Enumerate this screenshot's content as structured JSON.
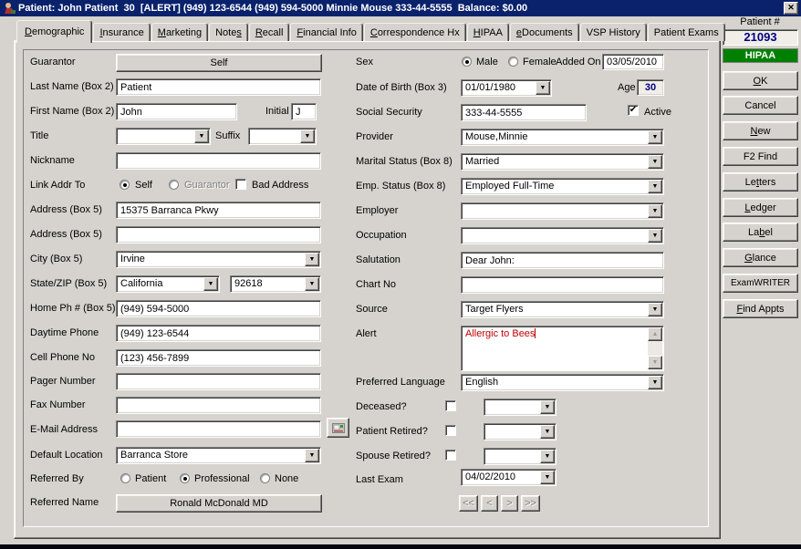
{
  "window": {
    "title": "Patient: John Patient  30  [ALERT] (949) 123-6544 (949) 594-5000 Minnie Mouse 333-44-5555  Balance: $0.00"
  },
  "icons": {
    "close": "✕",
    "dropdown": "▼",
    "check": "✔",
    "scroll_up": "▲",
    "scroll_down": "▼"
  },
  "colors": {
    "titlebar": "#0a216b",
    "chrome": "#d6d3ce",
    "hipaa_green": "#008000",
    "alert_red": "#c00000",
    "value_navy": "#000080"
  },
  "tabs": [
    {
      "pre": "",
      "key": "D",
      "post": "emographic"
    },
    {
      "pre": "",
      "key": "I",
      "post": "nsurance"
    },
    {
      "pre": "",
      "key": "M",
      "post": "arketing"
    },
    {
      "pre": "Note",
      "key": "s",
      "post": ""
    },
    {
      "pre": "",
      "key": "R",
      "post": "ecall"
    },
    {
      "pre": "",
      "key": "F",
      "post": "inancial Info"
    },
    {
      "pre": "",
      "key": "C",
      "post": "orrespondence Hx"
    },
    {
      "pre": "",
      "key": "H",
      "post": "IPAA"
    },
    {
      "pre": "",
      "key": "e",
      "post": "Documents"
    },
    {
      "pre": "VSP History",
      "key": "",
      "post": ""
    },
    {
      "pre": "Patient Exams",
      "key": "",
      "post": ""
    }
  ],
  "patient_panel": {
    "label": "Patient #",
    "number": "21093",
    "hipaa": "HIPAA"
  },
  "sidebar": {
    "buttons": [
      {
        "pre": "",
        "key": "O",
        "post": "K"
      },
      {
        "pre": "Cancel",
        "key": "",
        "post": ""
      },
      {
        "pre": "",
        "key": "N",
        "post": "ew"
      },
      {
        "pre": "F2 Find",
        "key": "",
        "post": ""
      },
      {
        "pre": "Le",
        "key": "t",
        "post": "ters"
      },
      {
        "pre": "",
        "key": "L",
        "post": "edger"
      },
      {
        "pre": "La",
        "key": "b",
        "post": "el"
      },
      {
        "pre": "",
        "key": "G",
        "post": "lance"
      },
      {
        "pre": "ExamWRITER",
        "key": "",
        "post": ""
      },
      {
        "pre": "",
        "key": "F",
        "post": "ind Appts"
      }
    ]
  },
  "form": {
    "left": {
      "guarantor_label": "Guarantor",
      "guarantor_value": "Self",
      "last_name_label": "Last Name (Box 2)",
      "last_name": "Patient",
      "first_name_label": "First Name (Box 2)",
      "first_name": "John",
      "initial_label": "Initial",
      "initial": "J",
      "title_label": "Title",
      "suffix_label": "Suffix",
      "nickname_label": "Nickname",
      "link_addr_label": "Link Addr To",
      "link_self": "Self",
      "link_guarantor": "Guarantor",
      "bad_address_label": "Bad Address",
      "address1_label": "Address (Box 5)",
      "address1": "15375 Barranca Pkwy",
      "address2_label": "Address (Box 5)",
      "city_label": "City (Box 5)",
      "city": "Irvine",
      "state_zip_label": "State/ZIP (Box 5)",
      "state": "California",
      "zip": "92618",
      "home_ph_label": "Home Ph # (Box 5)",
      "home_ph": "(949) 594-5000",
      "daytime_label": "Daytime Phone",
      "daytime": "(949) 123-6544",
      "cell_label": "Cell Phone No",
      "cell": "(123) 456-7899",
      "pager_label": "Pager Number",
      "fax_label": "Fax Number",
      "email_label": "E-Mail Address",
      "default_location_label": "Default Location",
      "default_location": "Barranca Store",
      "referred_by_label": "Referred By",
      "ref_patient": "Patient",
      "ref_professional": "Professional",
      "ref_none": "None",
      "referred_name_label": "Referred Name",
      "referred_name": "Ronald McDonald MD"
    },
    "right": {
      "sex_label": "Sex",
      "male": "Male",
      "female": "Female",
      "added_on_label": "Added On",
      "added_on": "03/05/2010",
      "dob_label": "Date of Birth (Box 3)",
      "dob": "01/01/1980",
      "age_label": "Age",
      "age": "30",
      "ssn_label": "Social Security",
      "ssn": "333-44-5555",
      "active_label": "Active",
      "provider_label": "Provider",
      "provider": "Mouse,Minnie",
      "marital_label": "Marital Status (Box 8)",
      "marital": "Married",
      "emp_status_label": "Emp. Status (Box 8)",
      "emp_status": "Employed Full-Time",
      "employer_label": "Employer",
      "occupation_label": "Occupation",
      "salutation_label": "Salutation",
      "salutation": "Dear John:",
      "chart_no_label": "Chart No",
      "source_label": "Source",
      "source": "Target Flyers",
      "alert_label": "Alert",
      "alert": "Allergic to Bees",
      "pref_lang_label": "Preferred Language",
      "pref_lang": "English",
      "deceased_label": "Deceased?",
      "patient_retired_label": "Patient Retired?",
      "spouse_retired_label": "Spouse Retired?",
      "last_exam_label": "Last Exam",
      "last_exam": "04/02/2010",
      "nav": [
        "<<",
        "<",
        ">",
        ">>"
      ]
    }
  }
}
